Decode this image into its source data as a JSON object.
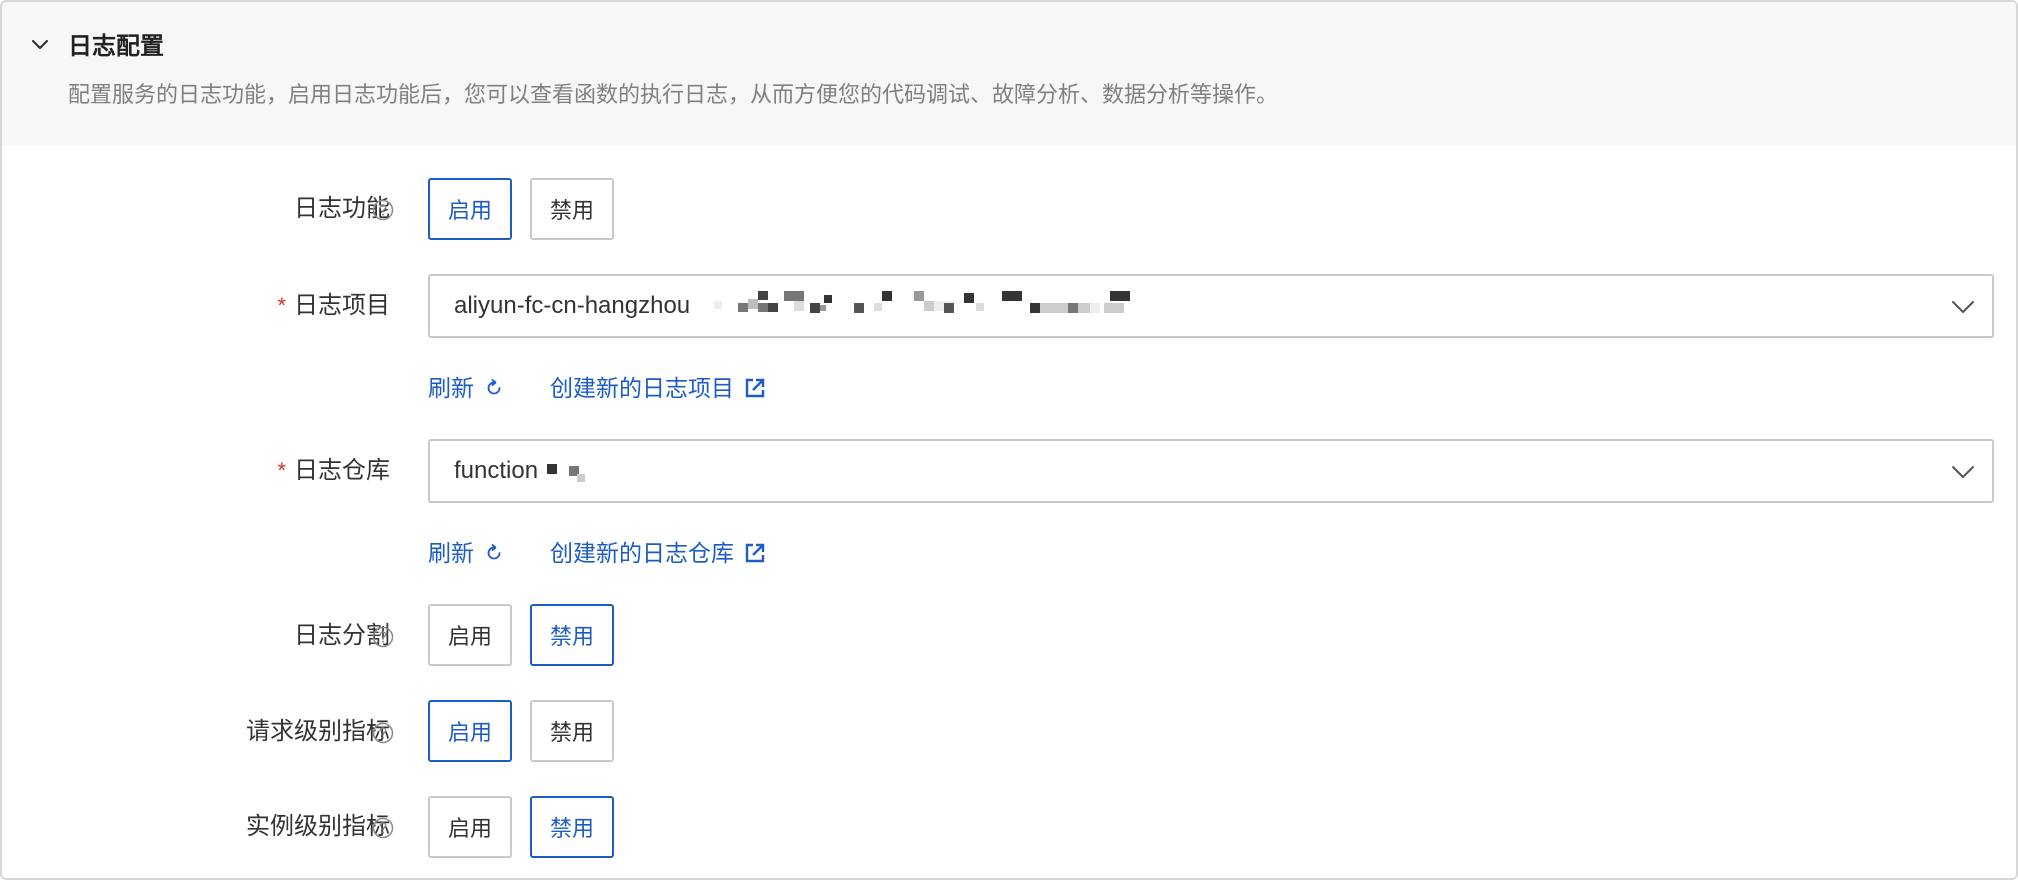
{
  "section": {
    "title": "日志配置",
    "description": "配置服务的日志功能，启用日志功能后，您可以查看函数的执行日志，从而方便您的代码调试、故障分析、数据分析等操作。"
  },
  "buttons": {
    "enable": "启用",
    "disable": "禁用"
  },
  "log_feature": {
    "label": "日志功能",
    "selected": "启用"
  },
  "log_project": {
    "label": "日志项目",
    "value": "aliyun-fc-cn-hangzhou",
    "refresh": "刷新",
    "create": "创建新的日志项目"
  },
  "log_store": {
    "label": "日志仓库",
    "value": "function",
    "refresh": "刷新",
    "create": "创建新的日志仓库"
  },
  "log_split": {
    "label": "日志分割",
    "selected": "禁用"
  },
  "request_metrics": {
    "label": "请求级别指标",
    "selected": "启用"
  },
  "instance_metrics": {
    "label": "实例级别指标",
    "selected": "禁用"
  },
  "required_mark": "*",
  "colors": {
    "accent": "#1d5cc7",
    "required": "#d93026",
    "header_bg": "#f6f7f9"
  },
  "icons": {
    "collapse": "chevron-down-icon",
    "help": "question-circle-icon",
    "refresh": "refresh-icon",
    "external": "external-link-icon",
    "dropdown": "chevron-down-icon"
  }
}
